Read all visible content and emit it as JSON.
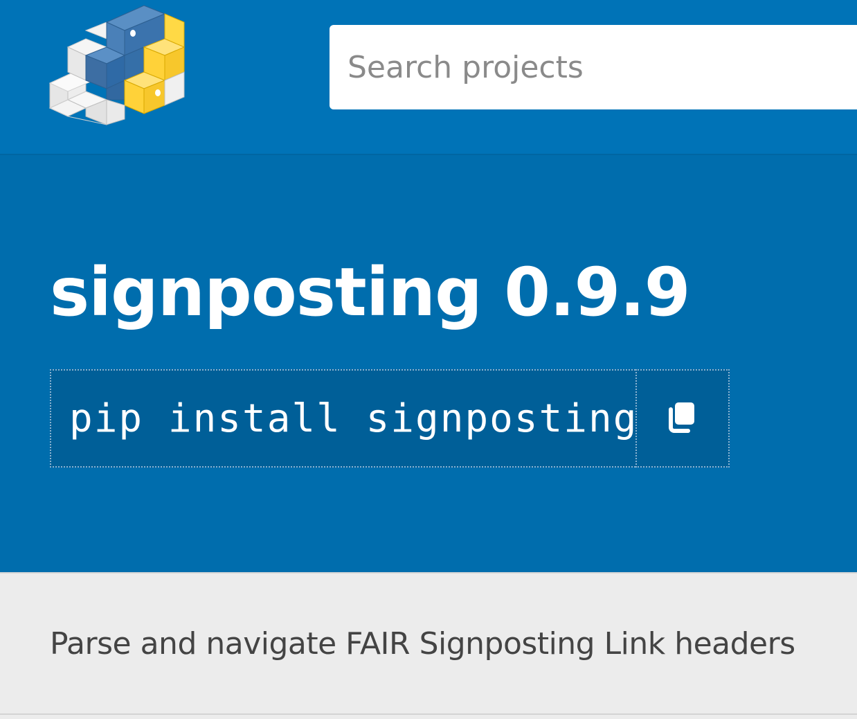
{
  "header": {
    "logo_icon": "pypi-logo-icon",
    "search": {
      "placeholder": "Search projects",
      "value": ""
    }
  },
  "package": {
    "title": "signposting 0.9.9",
    "pip_command": "pip install signposting",
    "copy_icon": "copy-icon",
    "description": "Parse and navigate FAIR Signposting Link headers"
  },
  "colors": {
    "header_blue": "#0073b7",
    "hero_blue": "#006dad",
    "pip_bg": "#005f98",
    "python_blue": "#3776ab",
    "python_yellow": "#ffd343",
    "band_gray": "#ececec"
  }
}
